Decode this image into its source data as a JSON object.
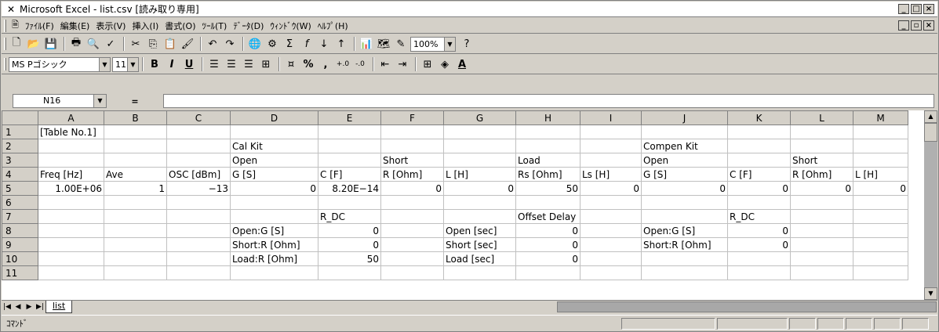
{
  "window": {
    "title": "Microsoft Excel - list.csv  [読み取り専用]"
  },
  "menu": [
    "ﾌｧｲﾙ(F)",
    "編集(E)",
    "表示(V)",
    "挿入(I)",
    "書式(O)",
    "ﾂｰﾙ(T)",
    "ﾃﾞｰﾀ(D)",
    "ｳｨﾝﾄﾞｳ(W)",
    "ﾍﾙﾌﾟ(H)"
  ],
  "toolbar": {
    "zoom": "100%"
  },
  "format": {
    "font": "MS Pゴシック",
    "size": "11",
    "bold": "B",
    "italic": "I",
    "underline": "U",
    "percent": "%",
    "comma": ","
  },
  "formula": {
    "cell": "N16",
    "eq": "="
  },
  "columns": [
    "A",
    "B",
    "C",
    "D",
    "E",
    "F",
    "G",
    "H",
    "I",
    "J",
    "K",
    "L",
    "M"
  ],
  "rows": [
    [
      "[Table No.1]",
      "",
      "",
      "",
      "",
      "",
      "",
      "",
      "",
      "",
      "",
      "",
      ""
    ],
    [
      "",
      "",
      "",
      "Cal Kit",
      "",
      "",
      "",
      "",
      "",
      "Compen Kit",
      "",
      "",
      ""
    ],
    [
      "",
      "",
      "",
      "Open",
      "",
      "Short",
      "",
      "Load",
      "",
      "Open",
      "",
      "Short",
      ""
    ],
    [
      "Freq [Hz]",
      "Ave",
      "OSC [dBm]",
      "G [S]",
      "C [F]",
      "R [Ohm]",
      "L [H]",
      "Rs [Ohm]",
      "Ls [H]",
      "G [S]",
      "C [F]",
      "R [Ohm]",
      "L [H]"
    ],
    [
      "1.00E+06",
      "1",
      "−13",
      "0",
      "8.20E−14",
      "0",
      "0",
      "50",
      "0",
      "0",
      "0",
      "0",
      "0"
    ],
    [
      "",
      "",
      "",
      "",
      "",
      "",
      "",
      "",
      "",
      "",
      "",
      "",
      ""
    ],
    [
      "",
      "",
      "",
      "",
      "R_DC",
      "",
      "",
      "Offset Delay",
      "",
      "",
      "R_DC",
      "",
      ""
    ],
    [
      "",
      "",
      "",
      "Open:G [S]",
      "0",
      "",
      "Open [sec]",
      "0",
      "",
      "Open:G [S]",
      "0",
      "",
      ""
    ],
    [
      "",
      "",
      "",
      "Short:R [Ohm]",
      "0",
      "",
      "Short [sec]",
      "0",
      "",
      "Short:R [Ohm]",
      "0",
      "",
      ""
    ],
    [
      "",
      "",
      "",
      "Load:R [Ohm]",
      "50",
      "",
      "Load [sec]",
      "0",
      "",
      "",
      "",
      "",
      ""
    ],
    [
      "",
      "",
      "",
      "",
      "",
      "",
      "",
      "",
      "",
      "",
      "",
      "",
      ""
    ]
  ],
  "sheet": {
    "tab": "list"
  },
  "status": {
    "mode": "ｺﾏﾝﾄﾞ"
  }
}
